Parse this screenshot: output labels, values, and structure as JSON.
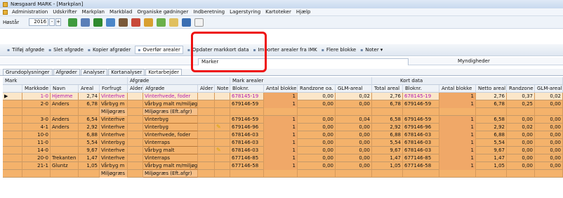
{
  "window": {
    "title": "Næsgaard MARK - [Markplan]"
  },
  "menu": [
    "Administration",
    "Udskrifter",
    "Markplan",
    "Markblad",
    "Organiske gødninger",
    "Indberetning",
    "Lagerstyring",
    "Kartoteker",
    "Hjælp"
  ],
  "toolbar": {
    "season_label": "Høstår",
    "year": "2016",
    "spin_minus": "-",
    "spin_plus": "+"
  },
  "actions": [
    "Tilføj afgrøde",
    "Slet afgrøde",
    "Kopier afgrøder",
    "Overfør arealer",
    "Opdater markkort data",
    "Importer arealer fra IMK",
    "Flere blokke",
    "Noter"
  ],
  "panel_tabs": {
    "marker": "Marker",
    "myndigheder": "Myndigheder"
  },
  "subtabs": [
    "Grundoplysninger",
    "Afgrøder",
    "Analyser",
    "Kortanalyser",
    "Kortarbejder"
  ],
  "group_headers": {
    "mark": "Mark",
    "afgrode": "Afgrøde",
    "mark_arealer": "Mark arealer",
    "kort_data": "Kort data"
  },
  "columns": [
    "Markkode",
    "Navn",
    "Areal",
    "Forfrugt",
    "Alder",
    "Afgrøde",
    "Alder",
    "Note",
    "Bloknr.",
    "Antal blokke",
    "Randzone oa.",
    "GLM-areal",
    "Total areal",
    "Bloknr.",
    "Antal blokke",
    "Netto areal",
    "Randzone ar.",
    "GLM-areal"
  ],
  "rows": [
    {
      "markkode": "1-0",
      "navn": "Hjemme",
      "areal": "2,74",
      "forfrugt": "Vinterhve",
      "afgrode": "Vinterhvede, foder",
      "note": "",
      "bloknr": "678145-19",
      "antal": "1",
      "randzone": "0,00",
      "glm": "0,02",
      "total": "2,76",
      "kbloknr": "678145-19",
      "kantal": "1",
      "netto": "2,76",
      "krand": "0,37",
      "kglm": "0,02"
    },
    {
      "markkode": "2-0",
      "navn": "Anders",
      "areal": "6,78",
      "forfrugt": "Vårbyg m",
      "afgrode": "Vårbyg malt m/miljøgræ",
      "note": "",
      "bloknr": "679146-59",
      "antal": "1",
      "randzone": "0,00",
      "glm": "0,00",
      "total": "6,78",
      "kbloknr": "679146-59",
      "kantal": "1",
      "netto": "6,78",
      "krand": "0,25",
      "kglm": "0,00"
    },
    {
      "markkode": "",
      "navn": "",
      "areal": "",
      "forfrugt": "Miljøgræs",
      "afgrode": "Miljøgræs (Eft.afgr)",
      "note": "",
      "bloknr": "",
      "antal": "",
      "randzone": "",
      "glm": "",
      "total": "",
      "kbloknr": "",
      "kantal": "",
      "netto": "",
      "krand": "",
      "kglm": ""
    },
    {
      "markkode": "3-0",
      "navn": "Anders",
      "areal": "6,54",
      "forfrugt": "Vinterhve",
      "afgrode": "Vinterbyg",
      "note": "",
      "bloknr": "679146-59",
      "antal": "1",
      "randzone": "0,00",
      "glm": "0,04",
      "total": "6,58",
      "kbloknr": "679146-59",
      "kantal": "1",
      "netto": "6,58",
      "krand": "0,00",
      "kglm": "0,00"
    },
    {
      "markkode": "4-1",
      "navn": "Anders",
      "areal": "2,92",
      "forfrugt": "Vinterhve",
      "afgrode": "Vinterbyg",
      "note": "note",
      "bloknr": "679146-96",
      "antal": "1",
      "randzone": "0,00",
      "glm": "0,00",
      "total": "2,92",
      "kbloknr": "679146-96",
      "kantal": "1",
      "netto": "2,92",
      "krand": "0,02",
      "kglm": "0,00"
    },
    {
      "markkode": "10-0",
      "navn": "",
      "areal": "6,88",
      "forfrugt": "Vinterhve",
      "afgrode": "Vinterhvede, foder",
      "note": "",
      "bloknr": "678146-03",
      "antal": "1",
      "randzone": "0,00",
      "glm": "0,00",
      "total": "6,88",
      "kbloknr": "678146-03",
      "kantal": "1",
      "netto": "6,88",
      "krand": "0,00",
      "kglm": "0,00"
    },
    {
      "markkode": "11-0",
      "navn": "",
      "areal": "5,54",
      "forfrugt": "Vinterbyg",
      "afgrode": "Vinterraps",
      "note": "",
      "bloknr": "678146-03",
      "antal": "1",
      "randzone": "0,00",
      "glm": "0,00",
      "total": "5,54",
      "kbloknr": "678146-03",
      "kantal": "1",
      "netto": "5,54",
      "krand": "0,00",
      "kglm": "0,00"
    },
    {
      "markkode": "14-0",
      "navn": "",
      "areal": "9,67",
      "forfrugt": "Vinterhve",
      "afgrode": "Vårbyg malt",
      "note": "note",
      "bloknr": "678146-03",
      "antal": "1",
      "randzone": "0,00",
      "glm": "0,00",
      "total": "9,67",
      "kbloknr": "678146-03",
      "kantal": "1",
      "netto": "9,67",
      "krand": "0,00",
      "kglm": "0,00"
    },
    {
      "markkode": "20-0",
      "navn": "Trekanten",
      "areal": "1,47",
      "forfrugt": "Vinterhve",
      "afgrode": "Vinterraps",
      "note": "",
      "bloknr": "677146-85",
      "antal": "1",
      "randzone": "0,00",
      "glm": "0,00",
      "total": "1,47",
      "kbloknr": "677146-85",
      "kantal": "1",
      "netto": "1,47",
      "krand": "0,00",
      "kglm": "0,00"
    },
    {
      "markkode": "21-1",
      "navn": "Gluntz",
      "areal": "1,05",
      "forfrugt": "Vårbyg m",
      "afgrode": "Vårbyg malt m/miljøgræ",
      "note": "",
      "bloknr": "677146-58",
      "antal": "1",
      "randzone": "0,00",
      "glm": "0,00",
      "total": "1,05",
      "kbloknr": "677146-58",
      "kantal": "1",
      "netto": "1,05",
      "krand": "0,00",
      "kglm": "0,00"
    },
    {
      "markkode": "",
      "navn": "",
      "areal": "",
      "forfrugt": "Miljøgræs",
      "afgrode": "Miljøgræs (Eft.afgr)",
      "note": "",
      "bloknr": "",
      "antal": "",
      "randzone": "",
      "glm": "",
      "total": "",
      "kbloknr": "",
      "kantal": "",
      "netto": "",
      "krand": "",
      "kglm": ""
    }
  ]
}
